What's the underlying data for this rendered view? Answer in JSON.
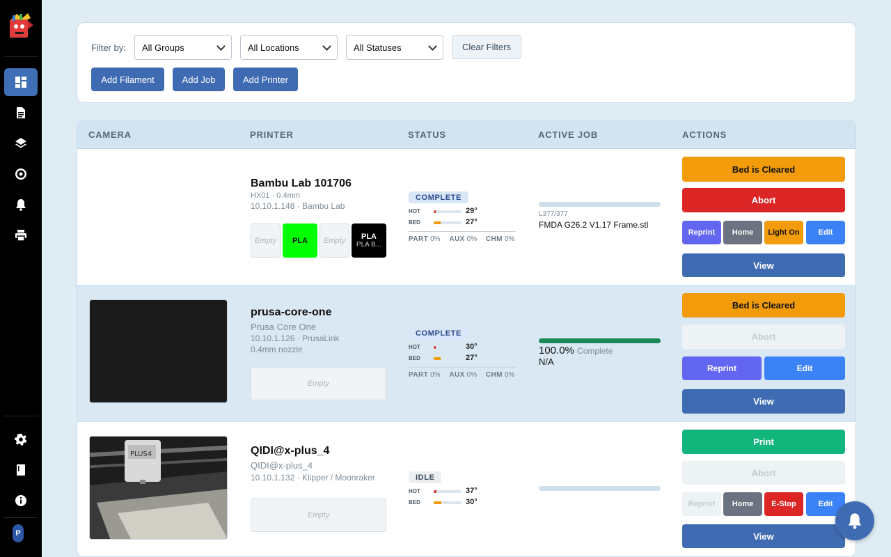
{
  "sidebar": {
    "avatar_letter": "P",
    "items": [
      {
        "icon": "dashboard-icon",
        "active": true
      },
      {
        "icon": "document-icon"
      },
      {
        "icon": "layers-icon"
      },
      {
        "icon": "spool-icon"
      },
      {
        "icon": "bell-icon"
      },
      {
        "icon": "printer-icon"
      }
    ],
    "bottom_items": [
      {
        "icon": "gear-icon"
      },
      {
        "icon": "book-icon"
      },
      {
        "icon": "info-icon"
      }
    ]
  },
  "filters": {
    "label": "Filter by:",
    "groups": "All Groups",
    "locations": "All Locations",
    "statuses": "All Statuses",
    "clear": "Clear Filters"
  },
  "toolbar": {
    "add_filament": "Add Filament",
    "add_job": "Add Job",
    "add_printer": "Add Printer"
  },
  "table": {
    "headers": [
      "CAMERA",
      "PRINTER",
      "STATUS",
      "ACTIVE JOB",
      "ACTIONS"
    ]
  },
  "rows": [
    {
      "name": "Bambu Lab 101706",
      "model": "HX01 · 0.4mm",
      "address": "10.10.1.148 · Bambu Lab",
      "slots": [
        {
          "label": "Empty"
        },
        {
          "label": "PLA",
          "color": "#00ff00"
        },
        {
          "label": "Empty"
        },
        {
          "label": "PLA",
          "sub": "PLA B...",
          "color": "#000000"
        }
      ],
      "status": "COMPLETE",
      "hot_label": "HOT",
      "hot": "29°",
      "hot_pct": 0.08,
      "bed_label": "BED",
      "bed": "27°",
      "bed_pct": 0.25,
      "part": "0%",
      "aux": "0%",
      "chm": "0%",
      "job_progress": 0,
      "job_layer": "L377/377",
      "job_file": "FMDA G26.2 V1.17 Frame.stl",
      "actions": {
        "bed": "Bed is Cleared",
        "abort": "Abort",
        "reprint": "Reprint",
        "home": "Home",
        "light": "Light On",
        "edit": "Edit",
        "view": "View"
      }
    },
    {
      "name": "prusa-core-one",
      "model": "Prusa Core One",
      "address": "10.10.1.126 · PrusaLink",
      "nozzle": "0.4mm nozzle",
      "slot": "Empty",
      "status": "COMPLETE",
      "hot_label": "HOT",
      "hot": "30°",
      "hot_pct": 0.08,
      "bed_label": "BED",
      "bed": "27°",
      "bed_pct": 0.25,
      "part": "0%",
      "aux": "0%",
      "chm": "0%",
      "job_progress": 1.0,
      "job_pct": "100.0%",
      "job_state": "Complete",
      "job_file": "N/A",
      "actions": {
        "bed": "Bed is Cleared",
        "abort": "Abort",
        "reprint": "Reprint",
        "edit": "Edit",
        "view": "View"
      }
    },
    {
      "name": "QIDI@x-plus_4",
      "model": "QIDI@x-plus_4",
      "address": "10.10.1.132 · Klipper / Moonraker",
      "slot": "Empty",
      "status": "IDLE",
      "hot_label": "HOT",
      "hot": "37°",
      "hot_pct": 0.1,
      "bed_label": "BED",
      "bed": "30°",
      "bed_pct": 0.28,
      "job_progress": 0,
      "actions": {
        "print": "Print",
        "abort": "Abort",
        "reprint": "Reprint",
        "home": "Home",
        "estop": "E-Stop",
        "edit": "Edit",
        "view": "View"
      }
    }
  ],
  "extras_labels": {
    "part": "PART",
    "aux": "AUX",
    "chm": "CHM"
  }
}
